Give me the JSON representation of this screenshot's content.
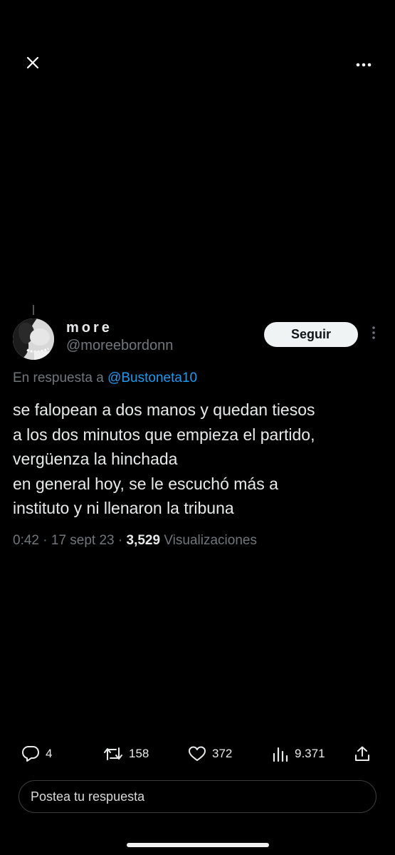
{
  "header": {
    "close_icon": "close-icon",
    "more_icon": "more-horizontal-icon"
  },
  "tweet": {
    "author_name": "more",
    "author_handle": "@moreebordonn",
    "follow_label": "Seguir",
    "reply_prefix": "En respuesta a",
    "reply_mention": "@Bustoneta10",
    "text_lines": [
      "se falopean a dos manos y quedan tiesos",
      "a los dos minutos que empieza el partido,",
      "vergüenza la hinchada",
      "en general hoy, se le escuchó más a",
      "instituto y ni llenaron la tribuna"
    ],
    "time": "0:42",
    "separator": "·",
    "date": "17 sept 23",
    "views_count": "3,529",
    "views_label": "Visualizaciones"
  },
  "actions": {
    "replies": "4",
    "retweets": "158",
    "likes": "372",
    "views": "9.371"
  },
  "reply_box": {
    "placeholder": "Postea tu respuesta"
  },
  "colors": {
    "background": "#000000",
    "text": "#e7e9ea",
    "secondary": "#71767b",
    "link": "#1d9bf0",
    "button_bg": "#eff3f4"
  }
}
